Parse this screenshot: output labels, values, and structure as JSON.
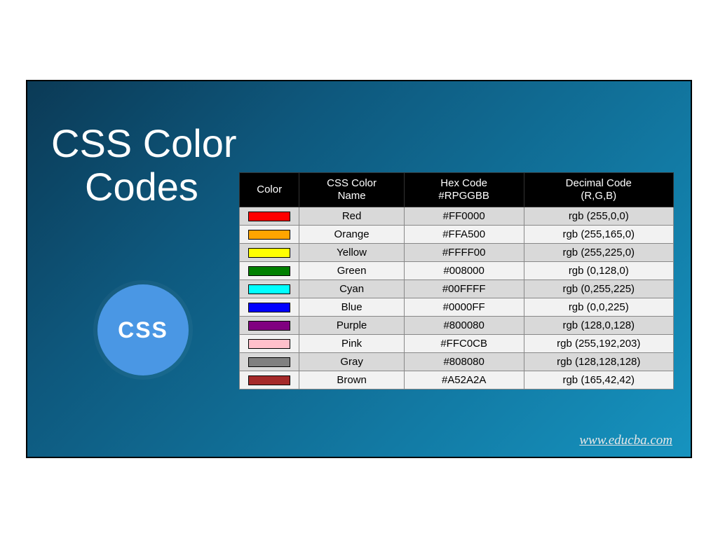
{
  "title": {
    "line1": "CSS Color",
    "line2": "Codes"
  },
  "badge": {
    "label": "CSS"
  },
  "footer": {
    "url": "www.educba.com"
  },
  "table": {
    "headers": {
      "swatch": "Color",
      "name_top": "CSS Color",
      "name_bottom": "Name",
      "hex_top": "Hex Code",
      "hex_bottom": "#RPGGBB",
      "rgb_top": "Decimal Code",
      "rgb_bottom": "(R,G,B)"
    },
    "rows": [
      {
        "swatch": "#FF0000",
        "name": "Red",
        "hex": "#FF0000",
        "rgb": "rgb (255,0,0)"
      },
      {
        "swatch": "#FFA500",
        "name": "Orange",
        "hex": "#FFA500",
        "rgb": "rgb (255,165,0)"
      },
      {
        "swatch": "#FFFF00",
        "name": "Yellow",
        "hex": "#FFFF00",
        "rgb": "rgb (255,225,0)"
      },
      {
        "swatch": "#008000",
        "name": "Green",
        "hex": "#008000",
        "rgb": "rgb (0,128,0)"
      },
      {
        "swatch": "#00FFFF",
        "name": "Cyan",
        "hex": "#00FFFF",
        "rgb": "rgb (0,255,225)"
      },
      {
        "swatch": "#0000FF",
        "name": "Blue",
        "hex": "#0000FF",
        "rgb": "rgb (0,0,225)"
      },
      {
        "swatch": "#800080",
        "name": "Purple",
        "hex": "#800080",
        "rgb": "rgb (128,0,128)"
      },
      {
        "swatch": "#FFC0CB",
        "name": "Pink",
        "hex": "#FFC0CB",
        "rgb": "rgb (255,192,203)"
      },
      {
        "swatch": "#808080",
        "name": "Gray",
        "hex": "#808080",
        "rgb": "rgb (128,128,128)"
      },
      {
        "swatch": "#A52A2A",
        "name": "Brown",
        "hex": "#A52A2A",
        "rgb": "rgb (165,42,42)"
      }
    ]
  }
}
